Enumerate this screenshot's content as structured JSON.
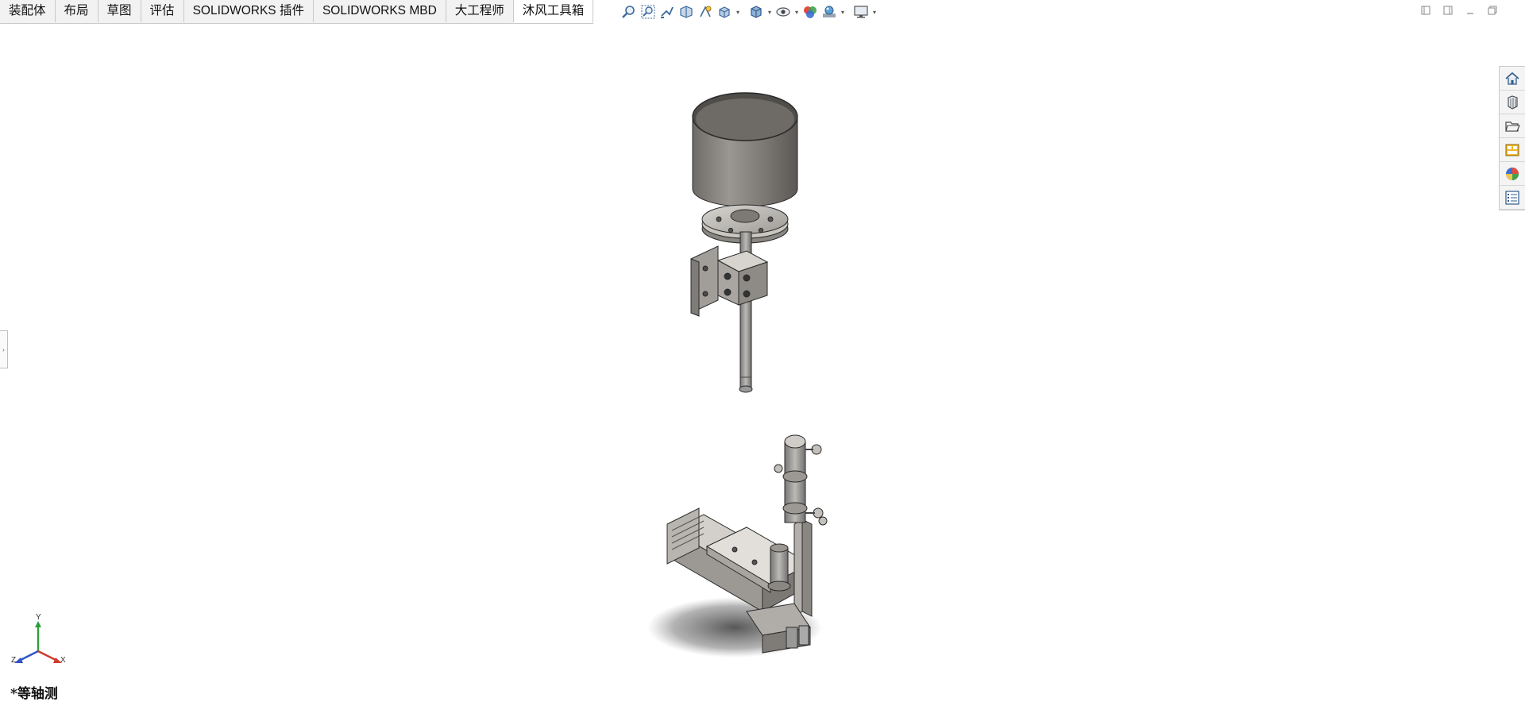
{
  "tabs": [
    {
      "label": "装配体",
      "active": false
    },
    {
      "label": "布局",
      "active": false
    },
    {
      "label": "草图",
      "active": false
    },
    {
      "label": "评估",
      "active": false
    },
    {
      "label": "SOLIDWORKS 插件",
      "active": false
    },
    {
      "label": "SOLIDWORKS MBD",
      "active": false
    },
    {
      "label": "大工程师",
      "active": false
    },
    {
      "label": "沐风工具箱",
      "active": true
    }
  ],
  "view_toolbar": {
    "icons": [
      "zoom-to-fit-icon",
      "zoom-to-area-icon",
      "previous-view-icon",
      "section-view-icon",
      "dynamic-annotation-icon",
      "view-orientation-icon",
      "display-style-icon",
      "hide-show-items-icon",
      "edit-appearance-icon",
      "apply-scene-icon",
      "view-settings-icon"
    ]
  },
  "task_pane": {
    "icons": [
      "home-icon",
      "design-library-icon",
      "file-explorer-icon",
      "view-palette-icon",
      "appearances-scenes-icon",
      "custom-properties-icon"
    ]
  },
  "triad": {
    "x": "X",
    "y": "Y",
    "z": "Z"
  },
  "view_label": "*等轴测",
  "colors": {
    "tab_active": "#ffffff",
    "tab_bar": "#f2f2f2",
    "model_gray": "#8c8a86"
  }
}
